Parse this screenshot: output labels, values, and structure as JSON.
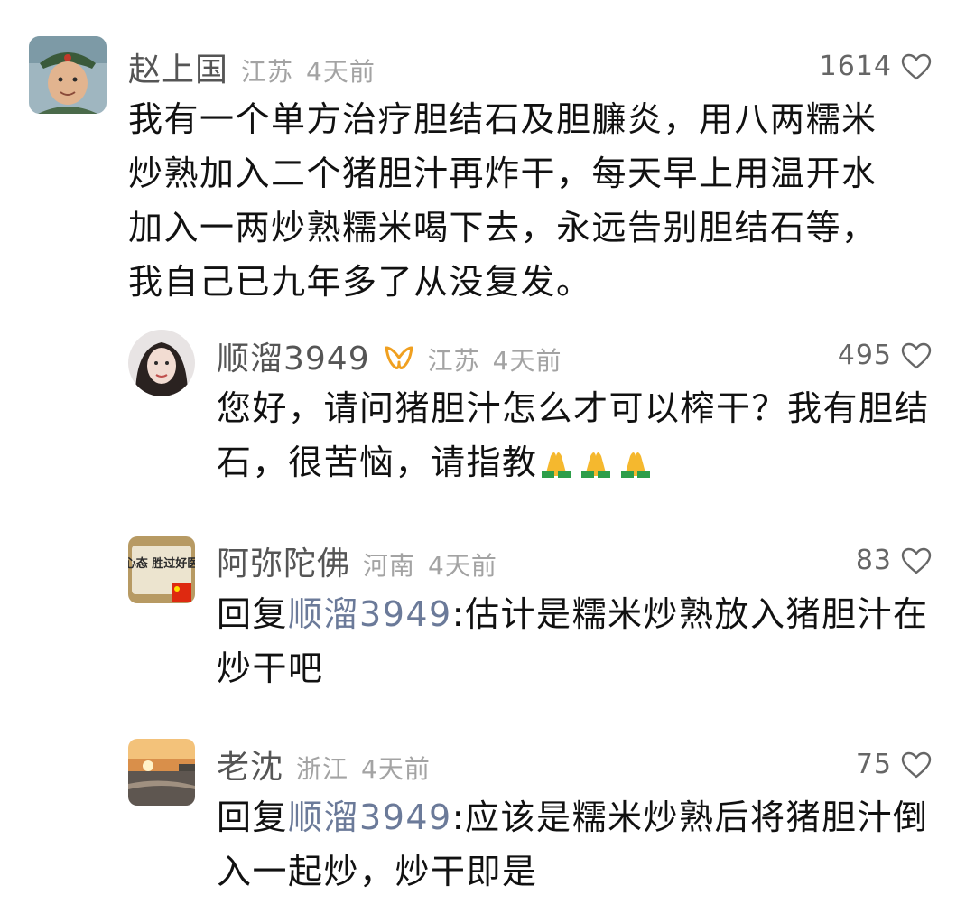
{
  "comments": [
    {
      "user": "赵上国",
      "location": "江苏",
      "time": "4天前",
      "likes": "1614",
      "lines": [
        "我有一个单方治疗胆结石及胆臁炎，用八两糯米",
        "炒熟加入二个猪胆汁再炸干，每天早上用温开水",
        "加入一两炒熟糯米喝下去，永远告别胆结石等，",
        "我自己已九年多了从没复发。"
      ]
    },
    {
      "user": "顺溜3949",
      "location": "江苏",
      "time": "4天前",
      "likes": "495",
      "line1": "您好，请问猪胆汁怎么才可以榨干？我有胆结",
      "line2": "石，很苦恼，请指教"
    },
    {
      "user": "阿弥陀佛",
      "location": "河南",
      "time": "4天前",
      "likes": "83",
      "reply_prefix": "回复",
      "reply_to": "顺溜3949",
      "line1_rest": ":估计是糯米炒熟放入猪胆汁在",
      "line2": "炒干吧",
      "avatar_text": "好心态 胜过好医生"
    },
    {
      "user": "老沈",
      "location": "浙江",
      "time": "4天前",
      "likes": "75",
      "reply_prefix": "回复",
      "reply_to": "顺溜3949",
      "line1_rest": ":应该是糯米炒熟后将猪胆汁倒",
      "line2": "入一起炒，炒干即是"
    }
  ],
  "icons": {
    "heart": "heart-outline-icon",
    "badge": "vip-badge-icon",
    "emoji": "folded-hands-emoji"
  },
  "colors": {
    "name": "#555555",
    "meta": "#a3a3a3",
    "reply_link": "#6b7a99",
    "badge": "#f0a020"
  }
}
